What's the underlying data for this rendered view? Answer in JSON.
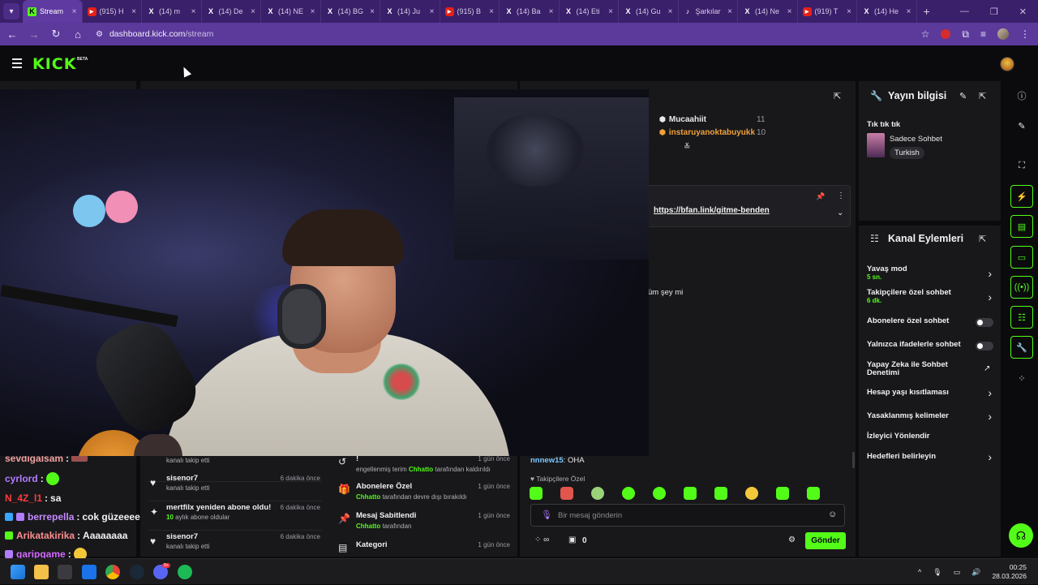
{
  "browser": {
    "tabs": [
      {
        "label": "Stream",
        "icon": "kick",
        "active": true
      },
      {
        "label": "(915) H",
        "icon": "yt"
      },
      {
        "label": "(14) m",
        "icon": "x"
      },
      {
        "label": "(14) De",
        "icon": "x"
      },
      {
        "label": "(14) NE",
        "icon": "x"
      },
      {
        "label": "(14) BG",
        "icon": "x"
      },
      {
        "label": "(14) Ju",
        "icon": "x"
      },
      {
        "label": "(915) B",
        "icon": "yt"
      },
      {
        "label": "(14) Ba",
        "icon": "x"
      },
      {
        "label": "(14) Eti",
        "icon": "x"
      },
      {
        "label": "(14) Gu",
        "icon": "x"
      },
      {
        "label": "Şarkılar",
        "icon": "tt"
      },
      {
        "label": "(14) Ne",
        "icon": "x"
      },
      {
        "label": "(919) T",
        "icon": "yt"
      },
      {
        "label": "(14) He",
        "icon": "x"
      }
    ],
    "url_host": "dashboard.kick.com",
    "url_path": "/stream"
  },
  "kick": {
    "logo": "KICK",
    "beta": "BETA"
  },
  "chat_overlay": [
    {
      "user": "sevdigalsam",
      "msg": "",
      "color": "#f0a0a0"
    },
    {
      "user": "cyrlord",
      "msg": "",
      "color": "#b27cff"
    },
    {
      "user": "N_4Z_l1",
      "msg": "sa",
      "color": "#ff3b3b"
    },
    {
      "user": "berrepella",
      "msg": "cok güzeeeeel",
      "color": "#c58bff"
    },
    {
      "user": "Arikatakirika",
      "msg": "Aaaaaaaa",
      "color": "#ff8e8e"
    },
    {
      "user": "garipgame",
      "msg": "",
      "color": "#d26bff"
    }
  ],
  "events": [
    {
      "title": "",
      "sub": "kanalı takip etti",
      "time": ""
    },
    {
      "title": "sisenor7",
      "sub": "kanalı takip etti",
      "time": "6 dakika önce"
    },
    {
      "title": "mertfilx yeniden abone oldu!",
      "sub_num": "10",
      "sub": "aylık abone oldular",
      "time": "6 dakika önce"
    },
    {
      "title": "sisenor7",
      "sub": "kanalı takip etti",
      "time": "6 dakika önce"
    }
  ],
  "logs": [
    {
      "title": "!",
      "sub_pre": "engellenmiş terim",
      "sub_user": "Chhatto",
      "sub_post": "tarafından kaldırıldı",
      "time": "1 gün önce"
    },
    {
      "title": "Abonelere Özel",
      "sub_user": "Chhatto",
      "sub_post": "tarafından devre dışı bırakıldı",
      "time": "1 gün önce"
    },
    {
      "title": "Mesaj Sabitlendi",
      "sub_user": "Chhatto",
      "sub_post": "tarafından",
      "time": "1 gün önce"
    },
    {
      "title": "Kategori",
      "time": "1 gün önce"
    }
  ],
  "chat": {
    "leaders": [
      {
        "name": "Mucaahiit",
        "count": "11",
        "color": "#e9e9ea"
      },
      {
        "name": "instaruyanoktabuyukk",
        "count": "10",
        "color": "#f0a13a"
      }
    ],
    "pinned_link": "https://bfan.link/gitme-benden",
    "partial_msg": "üm şey mi",
    "last_user": "nnnew15",
    "last_msg": "OHA",
    "follower_only": "Takipçilere Özel",
    "input_placeholder": "Bir mesaj gönderin",
    "points_count": "0",
    "send_label": "Gönder"
  },
  "stream_info": {
    "title": "Yayın bilgisi",
    "stream_title": "Tık tık tık",
    "category": "Sadece Sohbet",
    "language": "Turkish"
  },
  "channel_actions": {
    "title": "Kanal Eylemleri",
    "items": [
      {
        "label": "Yavaş mod",
        "sub": "5 sn.",
        "type": "chevron"
      },
      {
        "label": "Takipçilere özel sohbet",
        "sub": "6 dk.",
        "type": "chevron"
      },
      {
        "label": "Abonelere özel sohbet",
        "type": "toggle"
      },
      {
        "label": "Yalnızca ifadelerle sohbet",
        "type": "toggle"
      },
      {
        "label": "Yapay Zeka ile Sohbet Denetimi",
        "type": "external"
      },
      {
        "label": "Hesap yaşı kısıtlaması",
        "type": "chevron"
      },
      {
        "label": "Yasaklanmış kelimeler",
        "type": "chevron"
      },
      {
        "label": "İzleyici Yönlendir",
        "type": "none"
      },
      {
        "label": "Hedefleri belirleyin",
        "type": "chevron"
      }
    ]
  },
  "taskbar": {
    "time": "00:25",
    "date": "28.03.2026",
    "discord_badge": "9+"
  }
}
